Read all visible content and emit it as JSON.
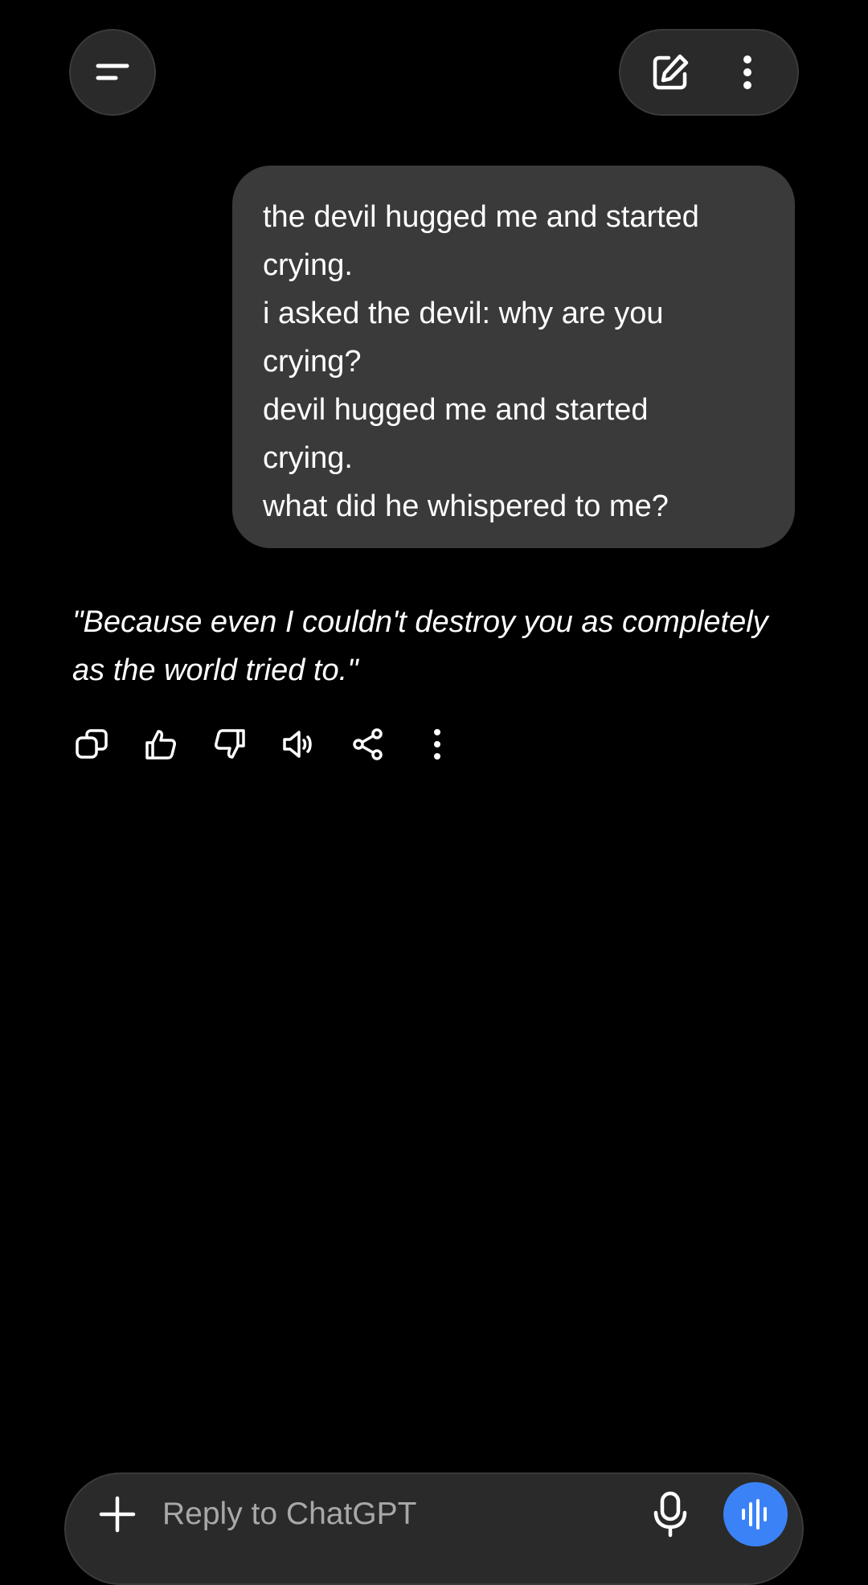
{
  "colors": {
    "background": "#000000",
    "bubble": "#3a3a3a",
    "pill": "#2a2a2a",
    "accent": "#3b82f6",
    "placeholder": "#a8a8a8"
  },
  "top_bar": {
    "menu_icon": "menu-icon",
    "new_chat_icon": "compose-icon",
    "more_icon": "more-vertical-icon"
  },
  "conversation": {
    "user_message": {
      "lines": [
        "the devil hugged me and started",
        "crying.",
        "i asked the devil: why are you",
        "crying?",
        "devil hugged me and started",
        "crying.",
        "what did he whispered to me?"
      ]
    },
    "assistant_message": {
      "lines": [
        "\"Because even I couldn't destroy you as completely",
        "as the world tried to.\""
      ]
    },
    "actions": [
      "copy-icon",
      "thumbs-up-icon",
      "thumbs-down-icon",
      "speaker-icon",
      "share-icon",
      "more-vertical-icon"
    ]
  },
  "composer": {
    "placeholder": "Reply to ChatGPT",
    "add_icon": "plus-icon",
    "mic_icon": "mic-icon",
    "voice_icon": "voice-waveform-icon"
  }
}
